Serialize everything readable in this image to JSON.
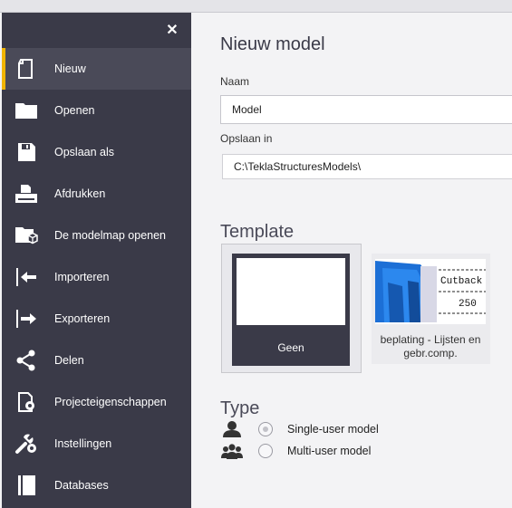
{
  "sidebar": {
    "close_label": "✕",
    "items": [
      {
        "label": "Nieuw",
        "icon": "new-document-icon",
        "active": true
      },
      {
        "label": "Openen",
        "icon": "folder-icon"
      },
      {
        "label": "Opslaan als",
        "icon": "save-icon"
      },
      {
        "label": "Afdrukken",
        "icon": "print-icon"
      },
      {
        "label": "De modelmap openen",
        "icon": "model-folder-icon"
      },
      {
        "label": "Importeren",
        "icon": "import-icon"
      },
      {
        "label": "Exporteren",
        "icon": "export-icon"
      },
      {
        "label": "Delen",
        "icon": "share-icon"
      },
      {
        "label": "Projecteigenschappen",
        "icon": "project-properties-icon"
      },
      {
        "label": "Instellingen",
        "icon": "settings-icon"
      },
      {
        "label": "Databases",
        "icon": "database-icon"
      }
    ]
  },
  "main": {
    "title": "Nieuw model",
    "name_label": "Naam",
    "name_value": "Model",
    "save_in_label": "Opslaan in",
    "save_in_value": "C:\\TeklaStructuresModels\\",
    "template_title": "Template",
    "templates": [
      {
        "label": "Geen",
        "selected": true
      },
      {
        "label": "beplating - Lijsten en gebr.comp.",
        "thumb_text_top": "Cutback",
        "thumb_text_bottom": "250"
      }
    ],
    "type_title": "Type",
    "types": [
      {
        "label": "Single-user model",
        "icon": "single-user-icon",
        "checked": true
      },
      {
        "label": "Multi-user model",
        "icon": "multi-user-icon",
        "checked": false
      }
    ]
  },
  "colors": {
    "sidebar_bg": "#3a3a48",
    "active_accent": "#f0b400",
    "content_bg": "#f3f3f5"
  }
}
